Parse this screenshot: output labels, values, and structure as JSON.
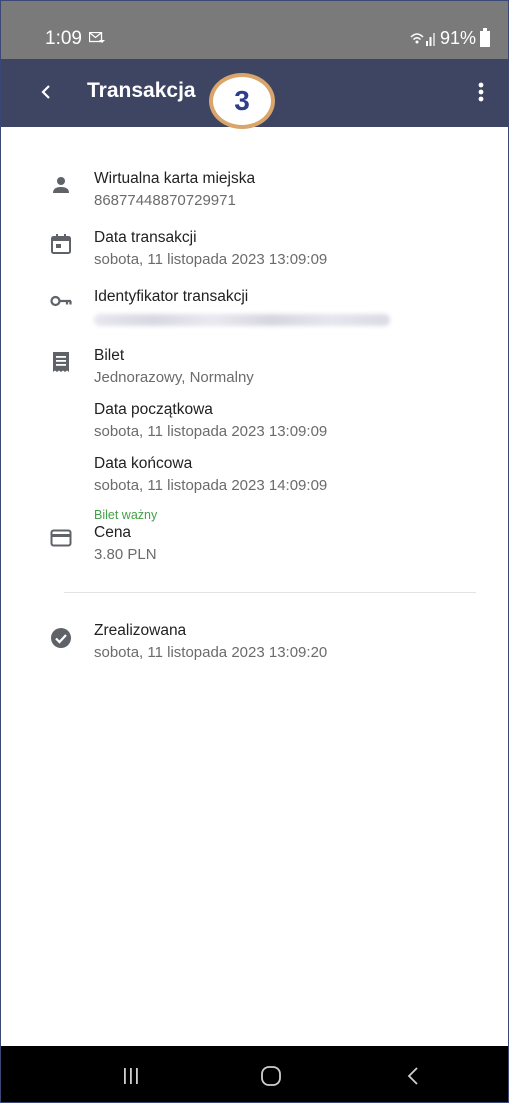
{
  "status_bar": {
    "time": "1:09",
    "battery": "91%"
  },
  "app_bar": {
    "title": "Transakcja"
  },
  "step_badge": "3",
  "details": {
    "card": {
      "label": "Wirtualna karta miejska",
      "value": "86877448870729971"
    },
    "date": {
      "label": "Data transakcji",
      "value": "sobota, 11 listopada 2023 13:09:09"
    },
    "transaction_id": {
      "label": "Identyfikator transakcji"
    },
    "ticket": {
      "label": "Bilet",
      "value": "Jednorazowy, Normalny",
      "start_label": "Data początkowa",
      "start_value": "sobota, 11 listopada 2023 13:09:09",
      "end_label": "Data końcowa",
      "end_value": "sobota, 11 listopada 2023 14:09:09",
      "status": "Bilet ważny"
    },
    "price": {
      "label": "Cena",
      "value": "3.80 PLN"
    }
  },
  "completed": {
    "label": "Zrealizowana",
    "value": "sobota, 11 listopada 2023 13:09:20"
  },
  "colors": {
    "app_bar": "#3d4563",
    "status_bar": "#7a7a7a",
    "valid_text": "#43a047",
    "badge_border": "#d9a56b",
    "badge_text": "#2f3e8c"
  },
  "icons": [
    "person-icon",
    "calendar-icon",
    "key-icon",
    "receipt-icon",
    "credit-card-icon",
    "check-circle-icon"
  ]
}
